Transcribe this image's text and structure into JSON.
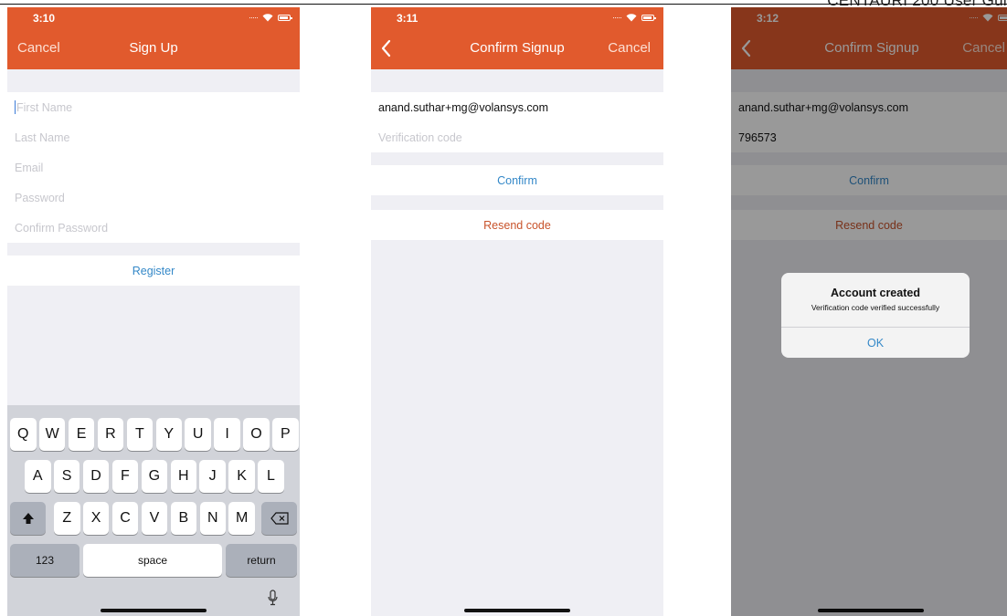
{
  "document": {
    "header_fragment": "CENTAURI 200 User Gui"
  },
  "colors": {
    "accent": "#e15a2d",
    "link_blue": "#3488c8",
    "resend_orange": "#c8532b",
    "background": "#efeff4"
  },
  "screens": [
    {
      "time": "3:10",
      "nav": {
        "left": "Cancel",
        "title": "Sign Up"
      },
      "fields": [
        {
          "placeholder": "First Name",
          "value": ""
        },
        {
          "placeholder": "Last Name",
          "value": ""
        },
        {
          "placeholder": "Email",
          "value": ""
        },
        {
          "placeholder": "Password",
          "value": ""
        },
        {
          "placeholder": "Confirm Password",
          "value": ""
        }
      ],
      "register_label": "Register",
      "keyboard": {
        "row1": [
          "Q",
          "W",
          "E",
          "R",
          "T",
          "Y",
          "U",
          "I",
          "O",
          "P"
        ],
        "row2": [
          "A",
          "S",
          "D",
          "F",
          "G",
          "H",
          "J",
          "K",
          "L"
        ],
        "row3": [
          "Z",
          "X",
          "C",
          "V",
          "B",
          "N",
          "M"
        ],
        "numbers": "123",
        "space": "space",
        "return": "return",
        "shift_icon": "shift-icon",
        "delete_icon": "delete-icon",
        "mic_icon": "microphone-icon"
      }
    },
    {
      "time": "3:11",
      "nav": {
        "left_icon": "back-chevron-icon",
        "title": "Confirm Signup",
        "right": "Cancel"
      },
      "email": "anand.suthar+mg@volansys.com",
      "code_placeholder": "Verification code",
      "code_value": "",
      "confirm_label": "Confirm",
      "resend_label": "Resend code"
    },
    {
      "time": "3:12",
      "nav": {
        "left_icon": "back-chevron-icon",
        "title": "Confirm Signup",
        "right": "Cancel"
      },
      "email": "anand.suthar+mg@volansys.com",
      "code_value": "796573",
      "confirm_label": "Confirm",
      "resend_label": "Resend code",
      "alert": {
        "title": "Account created",
        "message": "Verification code verified successfully",
        "button": "OK"
      }
    }
  ]
}
